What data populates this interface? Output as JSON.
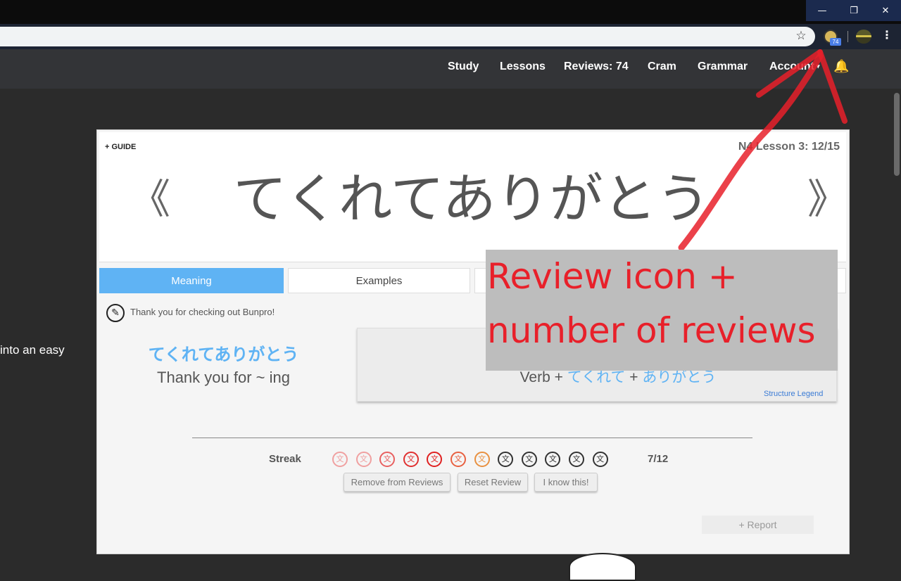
{
  "window": {
    "minimize_glyph": "—",
    "restore_glyph": "❐",
    "close_glyph": "✕"
  },
  "browser": {
    "star_glyph": "☆",
    "extension_badge": "74",
    "menu_glyph": "⋮"
  },
  "nav": {
    "items": [
      "Study",
      "Lessons",
      "Reviews: 74",
      "Cram",
      "Grammar",
      "Account"
    ],
    "account_caret": "▾",
    "bell_glyph": "🔔"
  },
  "side_text": "into an easy",
  "lesson": {
    "guide_label": "+ GUIDE",
    "lesson_tag": "N4 Lesson 3: 12/15",
    "title": "てくれてありがとう",
    "prev_arrow": "《",
    "next_arrow": "》",
    "tabs": [
      "Meaning",
      "Examples"
    ],
    "tip_icon": "✎",
    "tip_text": "Thank you for checking out Bunpro!",
    "grammar_jp": "てくれてありがとう",
    "grammar_en": "Thank you for ~ ing",
    "structure": {
      "prefix": "Verb + ",
      "part1": "てくれて",
      "plus": " + ",
      "part2": "ありがとう"
    },
    "structure_legend": "Structure Legend",
    "streak_label": "Streak",
    "streak_glyph": "文",
    "streak_count": "7/12",
    "streak_colors": [
      "#f0a0a0",
      "#f0a0a0",
      "#e86060",
      "#e03030",
      "#e02020",
      "#e86040",
      "#e89040",
      "#333333",
      "#333333",
      "#333333",
      "#333333",
      "#333333"
    ],
    "buttons": [
      "Remove from Reviews",
      "Reset Review",
      "I know this!"
    ],
    "report_label": "+ Report"
  },
  "annotation": {
    "line1": "Review icon +",
    "line2": "number of reviews",
    "color": "#e8202a"
  }
}
